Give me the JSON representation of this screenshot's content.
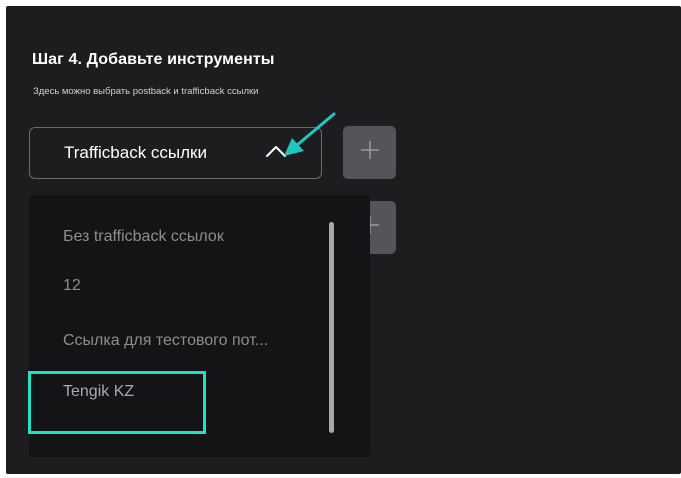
{
  "step": {
    "title": "Шаг 4. Добавьте инструменты",
    "subtitle": "Здесь можно выбрать postback и trafficback ссылки"
  },
  "select": {
    "label": "Trafficback ссылки",
    "state": "open",
    "chevron_icon": "chevron-up-icon"
  },
  "add_buttons": [
    {
      "icon": "plus-icon"
    },
    {
      "icon": "plus-icon"
    }
  ],
  "dropdown": {
    "items": [
      {
        "label": "Без trafficback ссылок"
      },
      {
        "label": "12"
      },
      {
        "label": "Ссылка для тестового пот..."
      },
      {
        "label": "Tengik KZ",
        "highlighted": true
      }
    ]
  },
  "colors": {
    "panel_bg": "#1d1d1f",
    "dropdown_bg": "#141416",
    "button_bg": "#54545a",
    "highlight": "#1fe1c5",
    "annotation_arrow": "#1fc7c0"
  }
}
